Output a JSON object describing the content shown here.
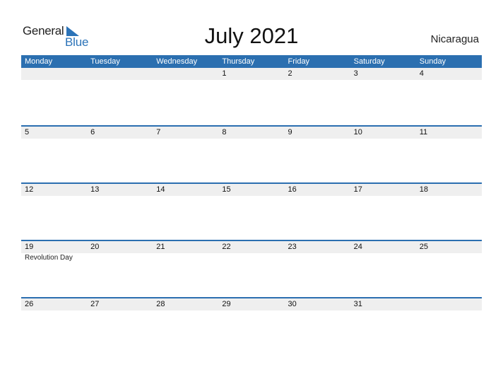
{
  "logo": {
    "word1": "General",
    "word2": "Blue",
    "accent": "#2b73b8"
  },
  "title": "July 2021",
  "country": "Nicaragua",
  "colors": {
    "header_bg": "#2b6fb0",
    "row_strip": "#efefef"
  },
  "weekdays": [
    "Monday",
    "Tuesday",
    "Wednesday",
    "Thursday",
    "Friday",
    "Saturday",
    "Sunday"
  ],
  "weeks": [
    {
      "days": [
        "",
        "",
        "",
        "1",
        "2",
        "3",
        "4"
      ],
      "events": [
        "",
        "",
        "",
        "",
        "",
        "",
        ""
      ]
    },
    {
      "days": [
        "5",
        "6",
        "7",
        "8",
        "9",
        "10",
        "11"
      ],
      "events": [
        "",
        "",
        "",
        "",
        "",
        "",
        ""
      ]
    },
    {
      "days": [
        "12",
        "13",
        "14",
        "15",
        "16",
        "17",
        "18"
      ],
      "events": [
        "",
        "",
        "",
        "",
        "",
        "",
        ""
      ]
    },
    {
      "days": [
        "19",
        "20",
        "21",
        "22",
        "23",
        "24",
        "25"
      ],
      "events": [
        "Revolution Day",
        "",
        "",
        "",
        "",
        "",
        ""
      ]
    },
    {
      "days": [
        "26",
        "27",
        "28",
        "29",
        "30",
        "31",
        ""
      ],
      "events": [
        "",
        "",
        "",
        "",
        "",
        "",
        ""
      ]
    }
  ]
}
